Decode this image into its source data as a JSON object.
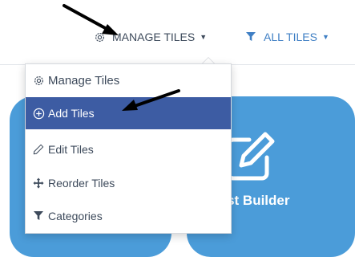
{
  "toolbar": {
    "manage_tiles_label": "MANAGE TILES",
    "all_tiles_label": "ALL TILES"
  },
  "dropdown": {
    "header": "Manage Tiles",
    "items": [
      {
        "label": "Add Tiles",
        "icon": "plus-circle-icon",
        "active": true
      },
      {
        "label": "Edit Tiles",
        "icon": "pencil-icon",
        "active": false
      },
      {
        "label": "Reorder Tiles",
        "icon": "move-icon",
        "active": false
      },
      {
        "label": "Categories",
        "icon": "filter-icon",
        "active": false
      }
    ]
  },
  "tiles": [
    {
      "label": ""
    },
    {
      "label": "Test Builder",
      "icon": "edit-square-icon"
    }
  ],
  "colors": {
    "tile": "#4b9cd9",
    "active_item": "#3d5ca3",
    "link_blue": "#3f7fc4",
    "text_dark": "#3d4a5b"
  }
}
